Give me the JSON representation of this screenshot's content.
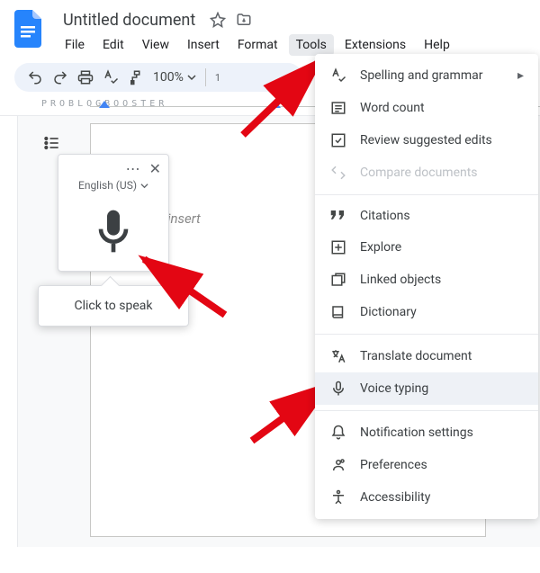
{
  "header": {
    "doc_title": "Untitled document"
  },
  "menu": {
    "file": "File",
    "edit": "Edit",
    "view": "View",
    "insert": "Insert",
    "format": "Format",
    "tools": "Tools",
    "extensions": "Extensions",
    "help": "Help"
  },
  "toolbar": {
    "zoom_value": "100%",
    "ruler_number": "1"
  },
  "watermark": "PROBLOGBOOSTER",
  "voice": {
    "language": "English (US)",
    "tooltip": "Click to speak"
  },
  "editor": {
    "placeholder": "Type @ to insert"
  },
  "tools_menu": {
    "spelling": "Spelling and grammar",
    "word_count": "Word count",
    "review": "Review suggested edits",
    "compare": "Compare documents",
    "citations": "Citations",
    "explore": "Explore",
    "linked": "Linked objects",
    "dictionary": "Dictionary",
    "translate": "Translate document",
    "voice_typing": "Voice typing",
    "notifications": "Notification settings",
    "preferences": "Preferences",
    "accessibility": "Accessibility"
  }
}
